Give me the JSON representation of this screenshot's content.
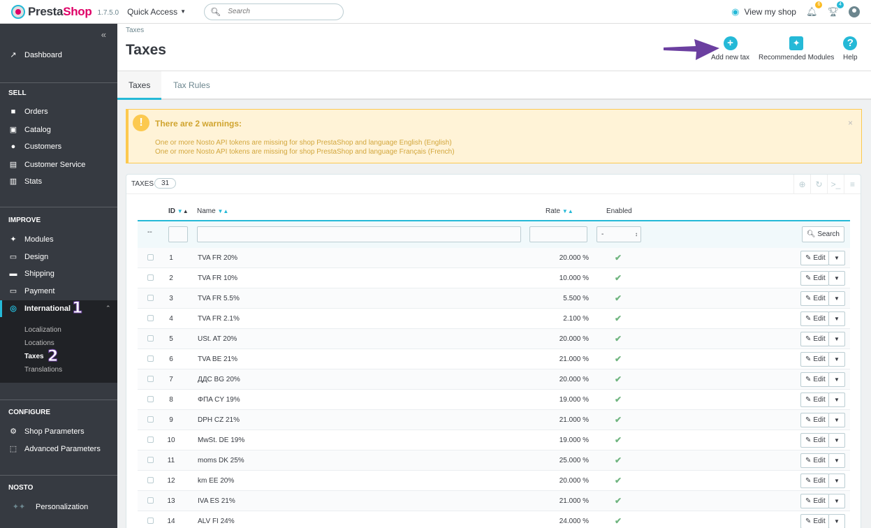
{
  "header": {
    "logo_prefix": "Presta",
    "logo_suffix": "Shop",
    "version": "1.7.5.0",
    "quick_access": "Quick Access",
    "search_placeholder": "Search",
    "view_shop": "View my shop",
    "notif_orders": "6",
    "notif_customers": "4"
  },
  "sidebar": {
    "dashboard": "Dashboard",
    "sell_section": "SELL",
    "sell_items": [
      "Orders",
      "Catalog",
      "Customers",
      "Customer Service",
      "Stats"
    ],
    "improve_section": "IMPROVE",
    "improve_items": [
      "Modules",
      "Design",
      "Shipping",
      "Payment",
      "International"
    ],
    "international_sub": [
      "Localization",
      "Locations",
      "Taxes",
      "Translations"
    ],
    "configure_section": "CONFIGURE",
    "configure_items": [
      "Shop Parameters",
      "Advanced Parameters"
    ],
    "nosto_section": "NOSTO",
    "nosto_items": [
      "Personalization"
    ],
    "annotation_1": "1",
    "annotation_2": "2"
  },
  "page": {
    "breadcrumb": "Taxes",
    "title": "Taxes",
    "toolbar": {
      "add_new_tax": "Add new tax",
      "recommended_modules": "Recommended Modules",
      "help": "Help"
    },
    "tabs": [
      "Taxes",
      "Tax Rules"
    ]
  },
  "warning": {
    "title": "There are 2 warnings:",
    "lines": [
      "One or more Nosto API tokens are missing for shop PrestaShop and language English (English)",
      "One or more Nosto API tokens are missing for shop PrestaShop and language Français (French)"
    ]
  },
  "table": {
    "panel_title": "TAXES",
    "count": "31",
    "columns": {
      "id": "ID",
      "name": "Name",
      "rate": "Rate",
      "enabled": "Enabled"
    },
    "filter_dash": "--",
    "filter_select": "-",
    "search_button": "Search",
    "edit_label": "Edit",
    "rows": [
      {
        "id": "1",
        "name": "TVA FR 20%",
        "rate": "20.000 %"
      },
      {
        "id": "2",
        "name": "TVA FR 10%",
        "rate": "10.000 %"
      },
      {
        "id": "3",
        "name": "TVA FR 5.5%",
        "rate": "5.500 %"
      },
      {
        "id": "4",
        "name": "TVA FR 2.1%",
        "rate": "2.100 %"
      },
      {
        "id": "5",
        "name": "USt. AT 20%",
        "rate": "20.000 %"
      },
      {
        "id": "6",
        "name": "TVA BE 21%",
        "rate": "21.000 %"
      },
      {
        "id": "7",
        "name": "ДДС BG 20%",
        "rate": "20.000 %"
      },
      {
        "id": "8",
        "name": "ΦΠΑ CY 19%",
        "rate": "19.000 %"
      },
      {
        "id": "9",
        "name": "DPH CZ 21%",
        "rate": "21.000 %"
      },
      {
        "id": "10",
        "name": "MwSt. DE 19%",
        "rate": "19.000 %"
      },
      {
        "id": "11",
        "name": "moms DK 25%",
        "rate": "25.000 %"
      },
      {
        "id": "12",
        "name": "km EE 20%",
        "rate": "20.000 %"
      },
      {
        "id": "13",
        "name": "IVA ES 21%",
        "rate": "21.000 %"
      },
      {
        "id": "14",
        "name": "ALV FI 24%",
        "rate": "24.000 %"
      }
    ]
  },
  "colors": {
    "accent": "#25b9d7",
    "sidebar_bg": "#363a41",
    "brand_pink": "#df0067",
    "warning_bg": "#fff3d7",
    "annotation_purple": "#6b3fa0"
  }
}
